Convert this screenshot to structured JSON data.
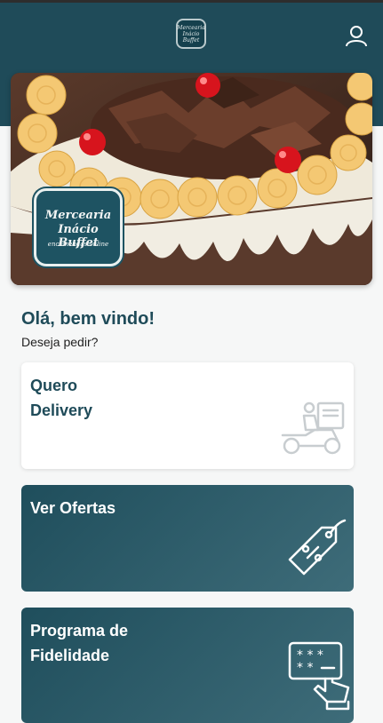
{
  "header": {
    "logo": {
      "line1": "Mercearia",
      "line2": "Inácio Buffet"
    },
    "user_icon": "user-icon"
  },
  "hero": {
    "logo": {
      "line1": "Mercearia",
      "line2": "Inácio Buffet",
      "tagline": "encomendas online"
    }
  },
  "welcome": {
    "title": "Olá, bem vindo!",
    "subtitle": "Deseja pedir?"
  },
  "cards": [
    {
      "label": "Quero\nDelivery",
      "icon": "delivery-scooter-icon"
    },
    {
      "label": "Ver Ofertas",
      "icon": "discount-tag-icon"
    },
    {
      "label": "Programa de\nFidelidade",
      "icon": "loyalty-card-icon"
    }
  ],
  "colors": {
    "brand": "#1f4b59",
    "background": "#f6f7f7",
    "card": "#ffffff"
  }
}
